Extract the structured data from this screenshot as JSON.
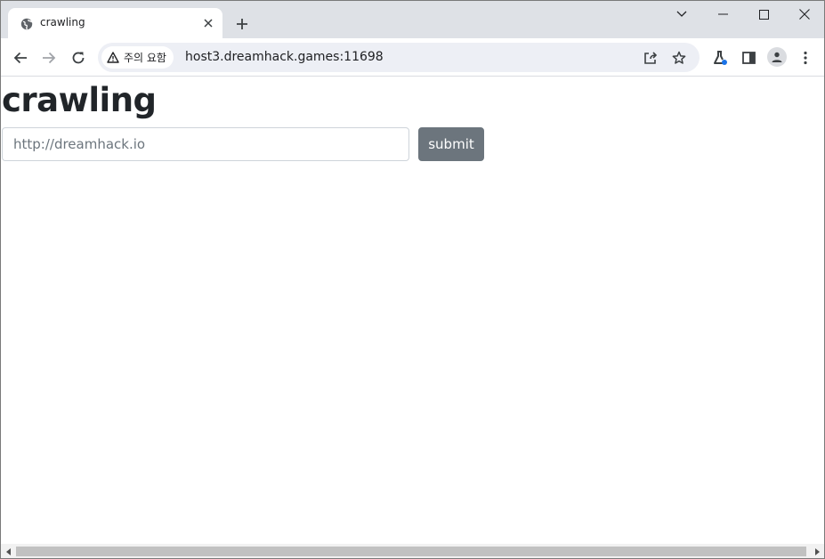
{
  "browser": {
    "tab": {
      "title": "crawling",
      "favicon": "globe-icon"
    },
    "omnibox": {
      "security_label": "주의 요함",
      "url": "host3.dreamhack.games:11698"
    },
    "colors": {
      "tabstrip_bg": "#dee1e6",
      "omnibox_bg": "#edeff5",
      "accent_blue": "#1a73e8"
    }
  },
  "page": {
    "title": "crawling",
    "input": {
      "value": "",
      "placeholder": "http://dreamhack.io"
    },
    "submit_label": "submit",
    "colors": {
      "text": "#212529",
      "button_bg": "#6c757d",
      "input_border": "#ced4da"
    }
  }
}
